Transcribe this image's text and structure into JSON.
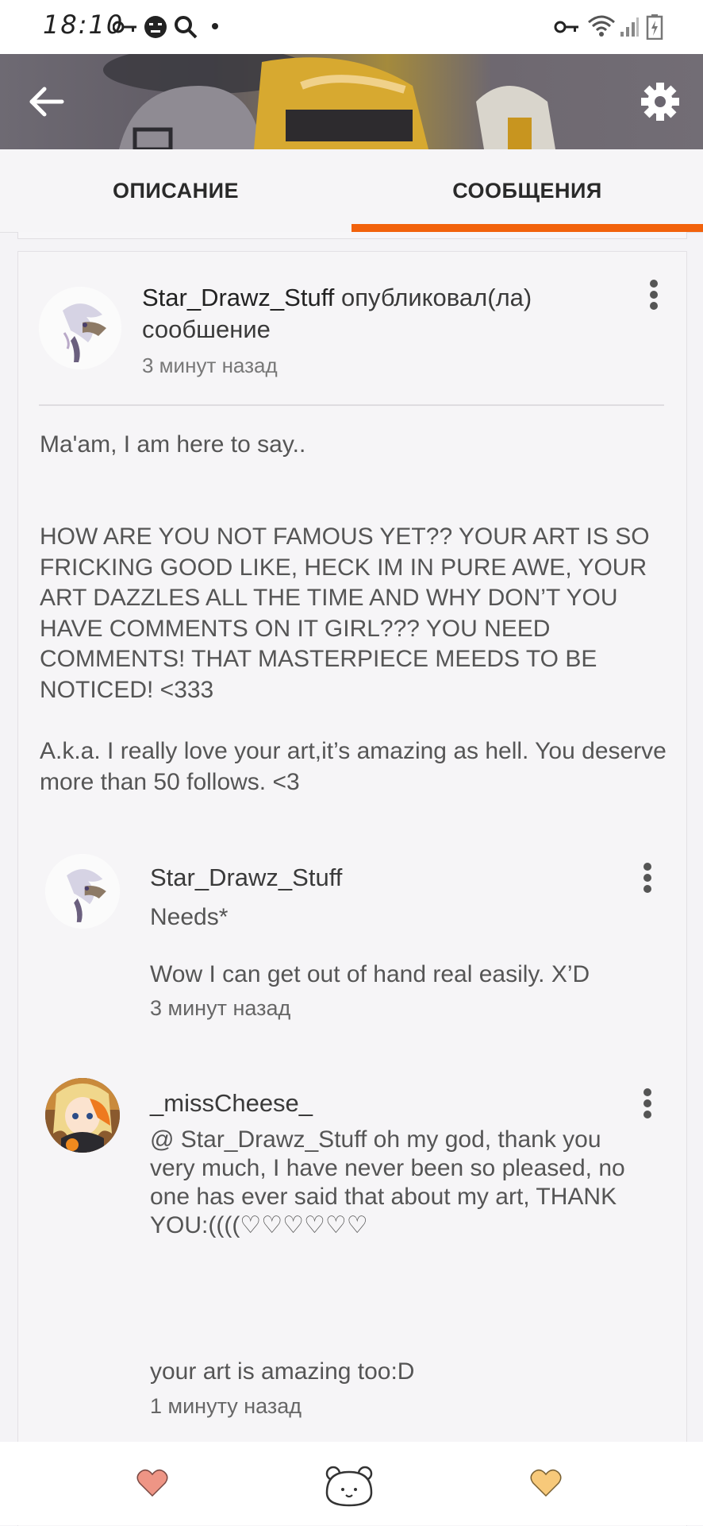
{
  "status_bar": {
    "time": "18:10"
  },
  "tabs": [
    {
      "label": "ОПИСАНИЕ"
    },
    {
      "label": "СООБЩЕНИЯ"
    }
  ],
  "post": {
    "author": "Star_Drawz_Stuff",
    "action": "опубликовал(ла) сообшение",
    "time": "3 минут назад",
    "paragraphs": [
      "Ma'am, I am here to say..",
      "HOW ARE YOU NOT FAMOUS YET?? YOUR ART IS SO FRICKING GOOD LIKE, HECK IM IN PURE AWE, YOUR ART DAZZLES ALL THE TIME AND WHY DON’T YOU HAVE COMMENTS ON IT GIRL??? YOU NEED COMMENTS! THAT MASTERPIECE MEEDS TO BE NOTICED! <333",
      "A.k.a. I really love your art,it’s amazing as hell. You deserve more than 50 follows.  <3"
    ]
  },
  "replies": [
    {
      "author": "Star_Drawz_Stuff",
      "lines": [
        "Needs*",
        "Wow I can get out of hand real easily. X’D"
      ],
      "time": "3 минут назад"
    },
    {
      "author": "_missCheese_",
      "lines": [
        "@ Star_Drawz_Stuff  oh my god, thank you very much, I have never been so pleased, no one has ever said that about my art, THANK YOU:((((♡♡♡♡♡♡",
        "your art is amazing too:D"
      ],
      "time": "1 минуту назад"
    }
  ],
  "colors": {
    "accent": "#f2620c",
    "heart_left": "#ee9585",
    "heart_right": "#f7c97a"
  },
  "icons": {
    "back": "arrow-left-icon",
    "settings": "gear-icon",
    "more": "more-vertical-icon",
    "like": "heart-icon",
    "chat": "bear-icon"
  }
}
